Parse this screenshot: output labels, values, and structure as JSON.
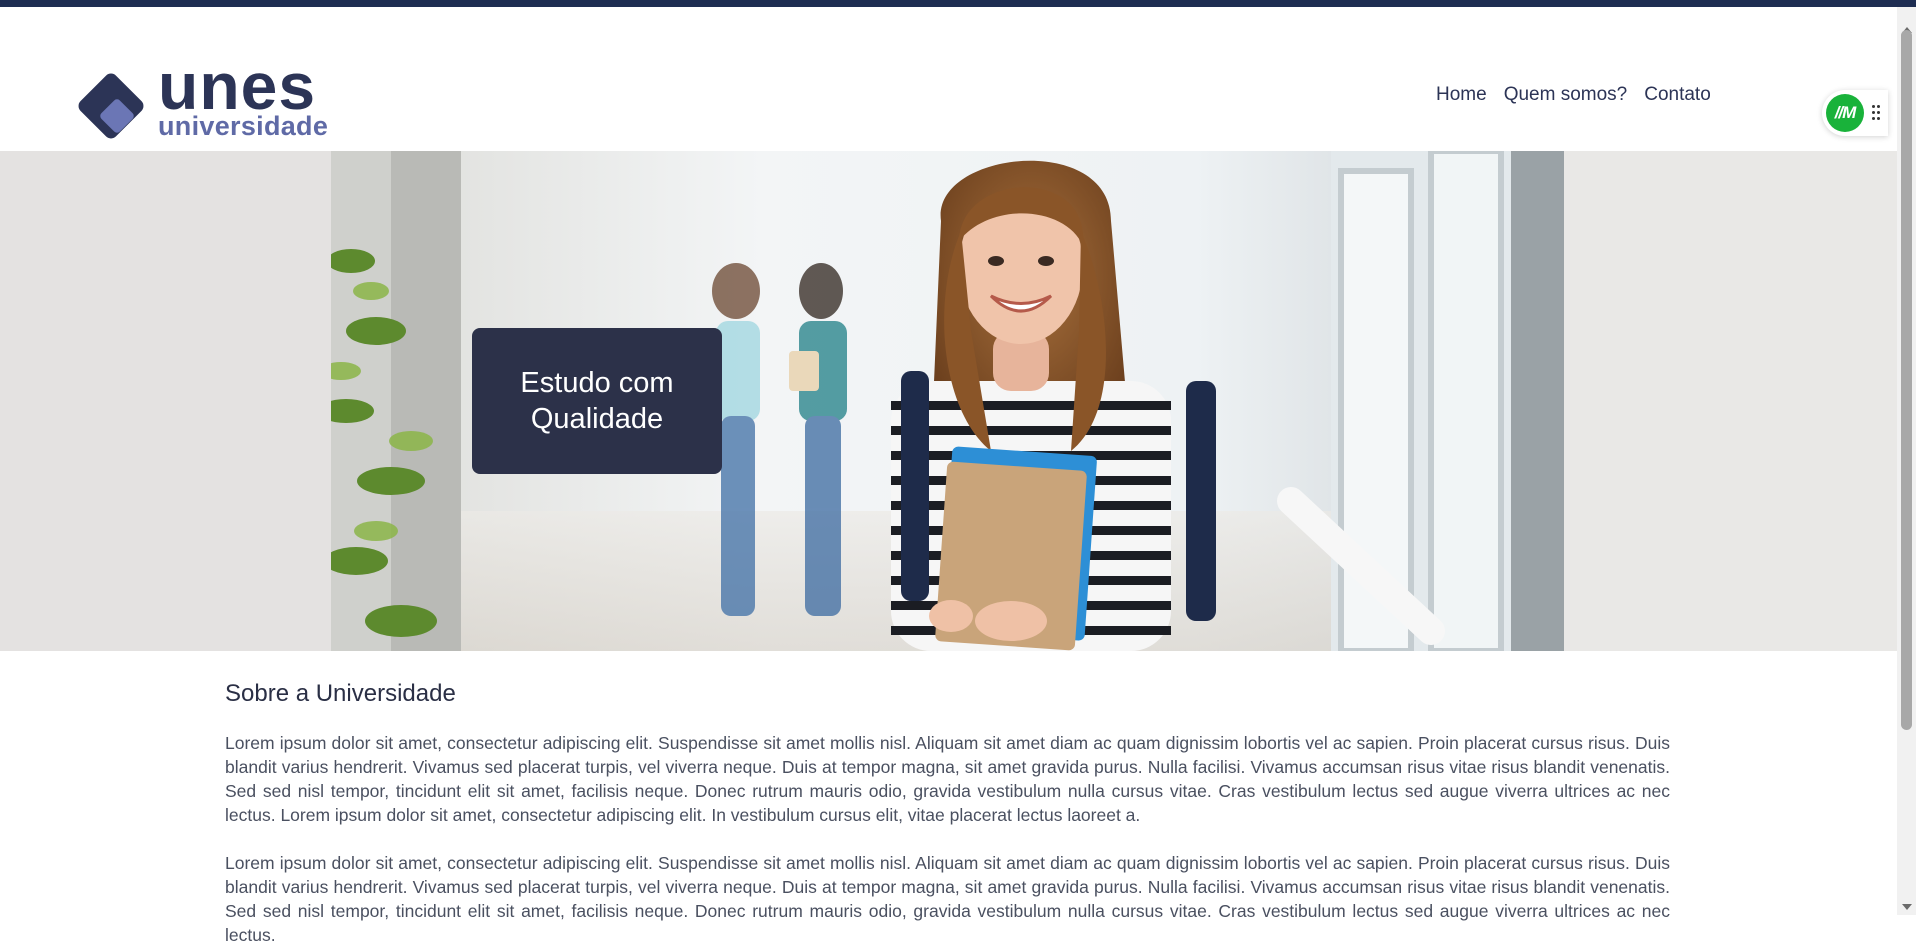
{
  "brand": {
    "name": "unes",
    "tagline": "universidade",
    "colors": {
      "primary": "#2c3456",
      "accent": "#5f6aa6",
      "top_strip": "#1e2d52"
    }
  },
  "nav": {
    "items": [
      {
        "label": "Home"
      },
      {
        "label": "Quem somos?"
      },
      {
        "label": "Contato"
      }
    ]
  },
  "widget": {
    "badge_text": "//M",
    "badge_color": "#19b23a",
    "icon": "drag-grip-icon"
  },
  "hero": {
    "card_line1": "Estudo com",
    "card_line2": "Qualidade",
    "card_color": "#2c3149"
  },
  "about": {
    "title": "Sobre a Universidade",
    "paragraphs": [
      "Lorem ipsum dolor sit amet, consectetur adipiscing elit. Suspendisse sit amet mollis nisl. Aliquam sit amet diam ac quam dignissim lobortis vel ac sapien. Proin placerat cursus risus. Duis blandit varius hendrerit. Vivamus sed placerat turpis, vel viverra neque. Duis at tempor magna, sit amet gravida purus. Nulla facilisi. Vivamus accumsan risus vitae risus blandit venenatis. Sed sed nisl tempor, tincidunt elit sit amet, facilisis neque. Donec rutrum mauris odio, gravida vestibulum nulla cursus vitae. Cras vestibulum lectus sed augue viverra ultrices ac nec lectus. Lorem ipsum dolor sit amet, consectetur adipiscing elit. In vestibulum cursus elit, vitae placerat lectus laoreet a.",
      "Lorem ipsum dolor sit amet, consectetur adipiscing elit. Suspendisse sit amet mollis nisl. Aliquam sit amet diam ac quam dignissim lobortis vel ac sapien. Proin placerat cursus risus. Duis blandit varius hendrerit. Vivamus sed placerat turpis, vel viverra neque. Duis at tempor magna, sit amet gravida purus. Nulla facilisi. Vivamus accumsan risus vitae risus blandit venenatis. Sed sed nisl tempor, tincidunt elit sit amet, facilisis neque. Donec rutrum mauris odio, gravida vestibulum nulla cursus vitae. Cras vestibulum lectus sed augue viverra ultrices ac nec lectus."
    ]
  }
}
